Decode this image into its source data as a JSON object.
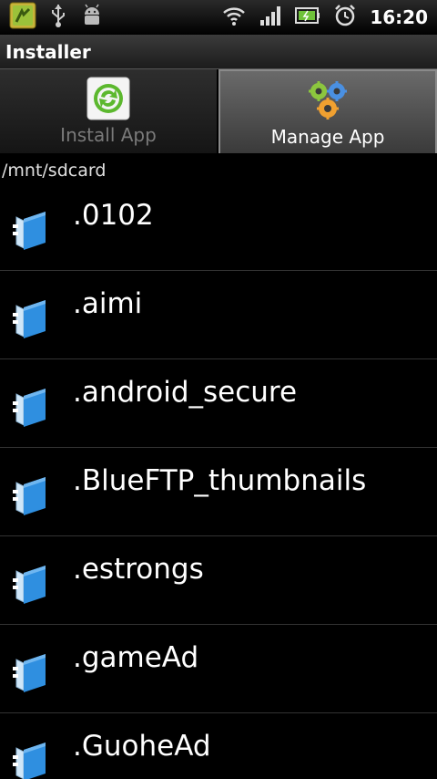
{
  "status_bar": {
    "time": "16:20",
    "icons": [
      "app-notification-icon",
      "usb-icon",
      "android-debug-icon",
      "wifi-icon",
      "signal-icon",
      "battery-icon",
      "alarm-icon"
    ]
  },
  "title_bar": {
    "title": "Installer"
  },
  "tabs": [
    {
      "label": "Install App",
      "icon": "recycle-install-icon",
      "selected": false
    },
    {
      "label": "Manage App",
      "icon": "gears-icon",
      "selected": true
    }
  ],
  "path": "/mnt/sdcard",
  "folders": [
    {
      "name": ".0102",
      "icon": "folder-icon"
    },
    {
      "name": ".aimi",
      "icon": "folder-icon"
    },
    {
      "name": ".android_secure",
      "icon": "folder-icon"
    },
    {
      "name": ".BlueFTP_thumbnails",
      "icon": "folder-icon"
    },
    {
      "name": ".estrongs",
      "icon": "folder-icon"
    },
    {
      "name": ".gameAd",
      "icon": "folder-icon"
    },
    {
      "name": ".GuoheAd",
      "icon": "folder-icon"
    }
  ],
  "colors": {
    "folder_blue": "#2f8fe0",
    "tab_selected": "#5a5a5a",
    "recycle_green": "#5cb82e"
  }
}
